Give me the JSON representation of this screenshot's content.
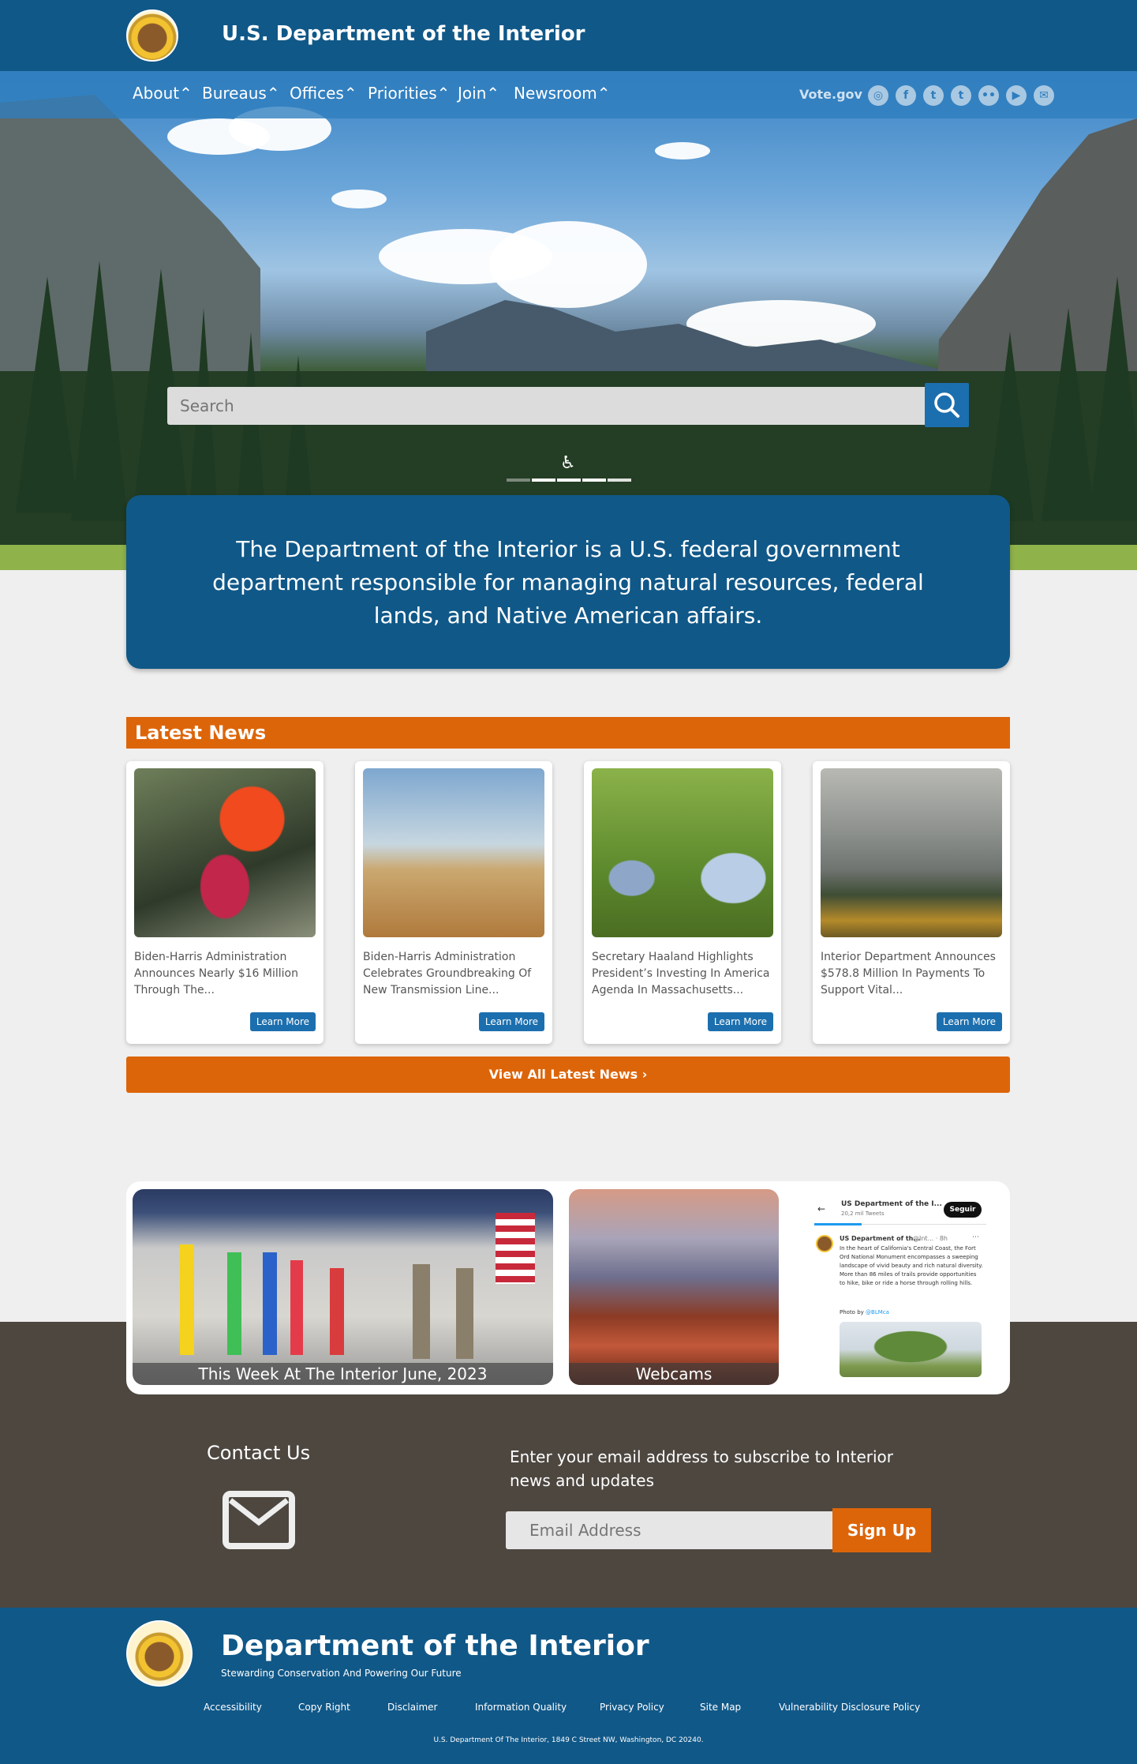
{
  "header": {
    "title": "U.S. Department of the Interior"
  },
  "nav": {
    "items": [
      {
        "label": "About"
      },
      {
        "label": "Bureaus"
      },
      {
        "label": "Offices"
      },
      {
        "label": "Priorities"
      },
      {
        "label": "Join"
      },
      {
        "label": "Newsroom"
      }
    ],
    "vote": "Vote.gov",
    "social_icons": [
      "instagram-icon",
      "facebook-icon",
      "twitter-icon",
      "tumblr-icon",
      "flickr-icon",
      "youtube-icon",
      "email-icon"
    ]
  },
  "hero": {
    "search_placeholder": "Search",
    "intro": "The Department of the Interior is a U.S. federal government department responsible for managing natural resources, federal lands, and Native American affairs."
  },
  "news": {
    "heading": "Latest News",
    "cards": [
      {
        "text": "Biden-Harris Administration Announces Nearly $16 Million Through The...",
        "button": "Learn More"
      },
      {
        "text": "Biden-Harris Administration Celebrates Groundbreaking Of New Transmission Line...",
        "button": "Learn More"
      },
      {
        "text": "Secretary Haaland Highlights President’s Investing In America Agenda In Massachusetts...",
        "button": "Learn More"
      },
      {
        "text": "Interior Department Announces $578.8 Million In Payments To Support Vital...",
        "button": "Learn More"
      }
    ],
    "view_all": "View All Latest News ›"
  },
  "media": {
    "week_caption": "This Week At The Interior June, 2023",
    "webcams_caption": "Webcams",
    "tweet": {
      "account": "US Department of the I...",
      "count": "20,2 mil Tweets",
      "follow": "Seguir",
      "author": "US Department of th...",
      "handle": "@Int... · 8h",
      "body": "In the heart of California's Central Coast, the Fort Ord National Monument encompasses a sweeping landscape of vivid beauty and rich natural diversity. More than 86 miles of trails provide opportunities to hike, bike or ride a horse through rolling hills.",
      "photo_by": "Photo by",
      "photo_handle": "@BLMca"
    }
  },
  "contact": {
    "title": "Contact Us",
    "subscribe_text": "Enter your email address to subscribe to Interior news and updates",
    "email_placeholder": "Email Address",
    "signup": "Sign Up"
  },
  "footer": {
    "title": "Department of the Interior",
    "tagline": "Stewarding Conservation And Powering Our Future",
    "links": [
      "Accessibility",
      "Copy Right",
      "Disclaimer",
      "Information Quality",
      "Privacy Policy",
      "Site Map",
      "Vulnerability Disclosure Policy"
    ],
    "address": "U.S. Department Of The Interior, 1849 C Street NW, Washington, DC 20240."
  },
  "colors": {
    "brand_blue": "#105888",
    "accent_orange": "#dd6509",
    "button_blue": "#1c6fae",
    "band_brown": "#4d4740"
  }
}
